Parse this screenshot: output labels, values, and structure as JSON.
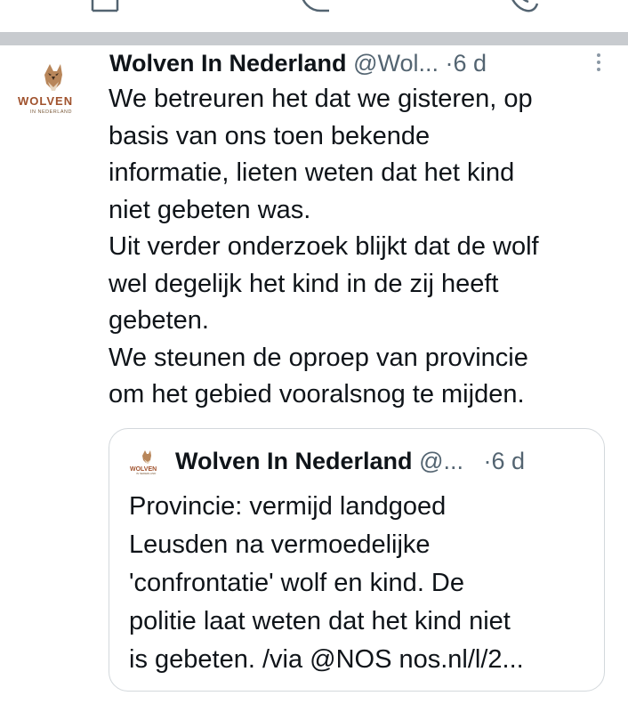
{
  "top_actions": {
    "icons": [
      "bookmark-icon",
      "reply-icon",
      "whatsapp-icon"
    ]
  },
  "tweet": {
    "author": {
      "name": "Wolven In Nederland",
      "handle": "@Wol...",
      "separator": "·",
      "time": "6 d",
      "avatar_text": "WOLVEN",
      "avatar_subtext": "IN NEDERLAND"
    },
    "lines": [
      "We betreuren het dat we gisteren, op",
      "basis van ons toen bekende",
      "informatie, lieten weten dat het kind",
      "niet gebeten was.",
      "Uit verder onderzoek blijkt dat de wolf",
      "wel degelijk het kind in de zij heeft",
      "gebeten.",
      "We steunen de oproep van provincie",
      "om het gebied vooralsnog te mijden."
    ],
    "quote": {
      "name": "Wolven In Nederland",
      "handle": "@...",
      "separator": "·",
      "time": "6 d",
      "lines": [
        "Provincie: vermijd landgoed",
        "Leusden na vermoedelijke",
        "'confrontatie' wolf en kind. De",
        "politie laat weten dat het kind niet",
        "is gebeten. /via @NOS nos.nl/l/2..."
      ]
    }
  },
  "colors": {
    "divider": "#c8cbcf",
    "text": "#0f1419",
    "muted": "#536471",
    "border": "#d3d8dc",
    "logo_brown": "#a0522d",
    "logo_red": "#c0392b"
  }
}
